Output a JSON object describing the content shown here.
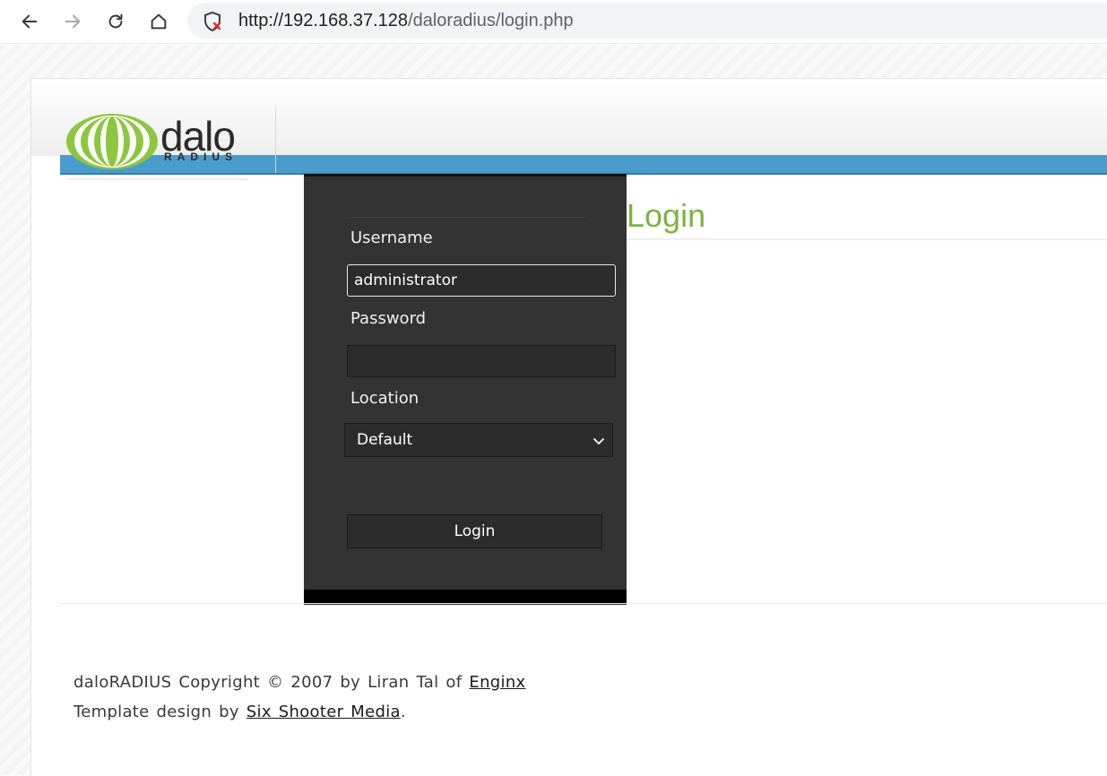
{
  "browser": {
    "url_host": "http://192.168.37.128",
    "url_path": "/daloradius/login.php"
  },
  "logo": {
    "wordmark": "dalo",
    "subtitle": "RADIUS"
  },
  "login_form": {
    "username_label": "Username",
    "username_value": "administrator",
    "password_label": "Password",
    "password_value": "",
    "location_label": "Location",
    "location_selected": "Default",
    "submit_label": "Login"
  },
  "content": {
    "title": "Login"
  },
  "footer": {
    "line1_prefix": "daloRADIUS Copyright © 2007 by Liran Tal of ",
    "line1_link": "Enginx",
    "line2_prefix": "Template design by ",
    "line2_link": "Six Shooter Media",
    "line2_suffix": "."
  },
  "colors": {
    "accent_green": "#7cb342",
    "header_blue": "#4a9ccb",
    "panel_dark": "#333333"
  }
}
